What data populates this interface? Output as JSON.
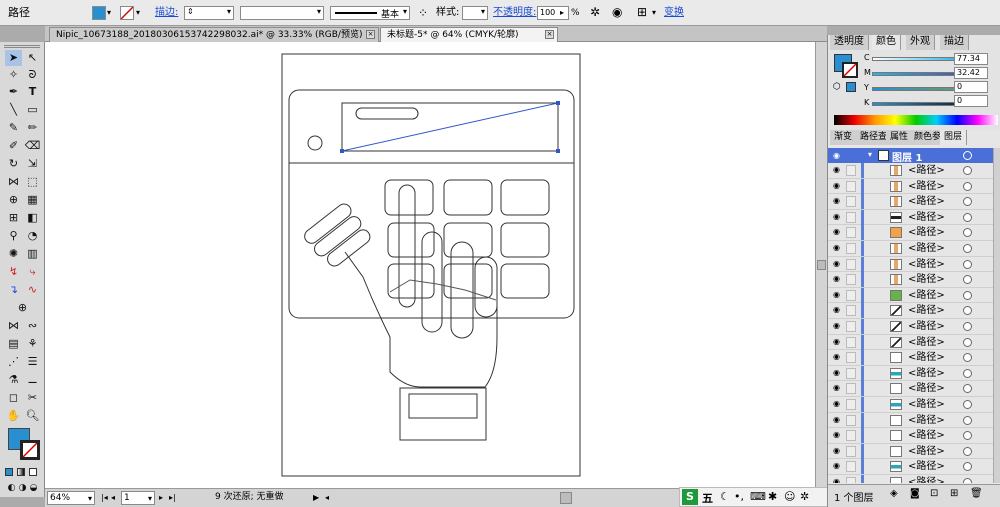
{
  "control_bar": {
    "object_type": "路径",
    "stroke_label": "描边:",
    "stroke_profile": "基本",
    "style_label": "样式:",
    "opacity_label": "不透明度:",
    "opacity_value": "100",
    "opacity_unit": "%",
    "transform_label": "变换"
  },
  "doc_tabs": [
    {
      "label": "Nipic_10673188_20180306153742298032.ai* @ 33.33% (RGB/预览)"
    },
    {
      "label": "未标题-5* @ 64% (CMYK/轮廓)"
    }
  ],
  "status_bar": {
    "zoom": "64%",
    "artboard": "1",
    "history": "9 次还原; 无重做"
  },
  "color_panel": {
    "tabs": [
      "透明度",
      "颜色",
      "外观",
      "描边"
    ],
    "active_tab": "颜色",
    "channels": [
      {
        "label": "C",
        "value": "77.34"
      },
      {
        "label": "M",
        "value": "32.42"
      },
      {
        "label": "Y",
        "value": "0"
      },
      {
        "label": "K",
        "value": "0"
      }
    ],
    "fill_color": "#2a8fd0"
  },
  "layers_panel": {
    "tabs": [
      "渐变",
      "路径查",
      "属性",
      "颜色参",
      "图层"
    ],
    "active_tab": "图层",
    "layer_name": "图层 1",
    "items": [
      {
        "name": "<路径>",
        "thumb": "tan"
      },
      {
        "name": "<路径>",
        "thumb": "tan"
      },
      {
        "name": "<路径>",
        "thumb": "tan"
      },
      {
        "name": "<路径>",
        "thumb": "dark"
      },
      {
        "name": "<路径>",
        "thumb": "orange"
      },
      {
        "name": "<路径>",
        "thumb": "tan"
      },
      {
        "name": "<路径>",
        "thumb": "tan"
      },
      {
        "name": "<路径>",
        "thumb": "tan"
      },
      {
        "name": "<路径>",
        "thumb": "green"
      },
      {
        "name": "<路径>",
        "thumb": "slash"
      },
      {
        "name": "<路径>",
        "thumb": "slash"
      },
      {
        "name": "<路径>",
        "thumb": "slash"
      },
      {
        "name": "<路径>",
        "thumb": "plain"
      },
      {
        "name": "<路径>",
        "thumb": "teal"
      },
      {
        "name": "<路径>",
        "thumb": "plain"
      },
      {
        "name": "<路径>",
        "thumb": "teal"
      },
      {
        "name": "<路径>",
        "thumb": "plain"
      },
      {
        "name": "<路径>",
        "thumb": "plain"
      },
      {
        "name": "<路径>",
        "thumb": "plain"
      },
      {
        "name": "<路径>",
        "thumb": "teal"
      },
      {
        "name": "<路径>",
        "thumb": "plain"
      }
    ],
    "footer_label": "1 个图层"
  },
  "ime_bar": {
    "label": "五"
  },
  "colors": {
    "accent_blue": "#2a8fd0",
    "panel_bg": "#e3e3e3",
    "selection_blue": "#4a6fd6"
  }
}
